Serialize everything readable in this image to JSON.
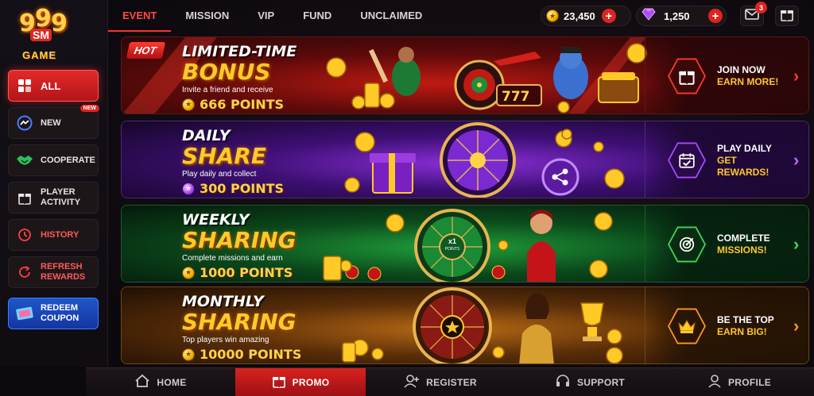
{
  "logo": {
    "digits": [
      "9",
      "9",
      "9"
    ],
    "mark": "SM",
    "text": "GAME"
  },
  "sidebar": {
    "items": [
      {
        "label": "ALL",
        "icon": "grid-icon",
        "active": true
      },
      {
        "label": "NEW",
        "icon": "messenger-icon",
        "badge": "NEW"
      },
      {
        "label": "COOPERATE",
        "icon": "handshake-icon"
      },
      {
        "label": "PLAYER ACTIVITY",
        "icon": "gift-icon"
      },
      {
        "label": "HISTORY",
        "icon": "history-icon"
      },
      {
        "label": "REFRESH REWARDS",
        "icon": "refresh-icon"
      },
      {
        "label": "REDEEM COUPON",
        "icon": "coupon-icon"
      }
    ]
  },
  "tabs": [
    "EVENT",
    "MISSION",
    "VIP",
    "FUND",
    "UNCLAIMED"
  ],
  "wallet": {
    "coins": "23,450",
    "gems": "1,250",
    "mail_count": "3"
  },
  "banners": [
    {
      "hot": "HOT",
      "line1": "LIMITED-TIME",
      "line2": "BONUS",
      "sub": "Invite a friend and receive",
      "points": "666 POINTS",
      "cta1": "JOIN NOW",
      "cta2": "EARN MORE!",
      "cta_icon": "gift-icon",
      "accent": "#ff2a2a",
      "theme": "red"
    },
    {
      "line1": "DAILY",
      "line2": "SHARE",
      "sub": "Play daily and collect",
      "points": "300 POINTS",
      "cta1": "PLAY DAILY",
      "cta2": "GET REWARDS!",
      "cta_icon": "calendar-check-icon",
      "accent": "#a54bff",
      "theme": "purple"
    },
    {
      "line1": "WEEKLY",
      "line2": "SHARING",
      "sub": "Complete missions and earn",
      "points": "1000 POINTS",
      "cta1": "COMPLETE",
      "cta2": "MISSIONS!",
      "cta_icon": "target-icon",
      "accent": "#3ddc5a",
      "theme": "green",
      "wheel_label": "x1",
      "wheel_sub": "POINTS"
    },
    {
      "line1": "MONTHLY",
      "line2": "SHARING",
      "sub": "Top players win amazing",
      "points": "10000 POINTS",
      "cta1": "BE THE TOP",
      "cta2": "EARN BIG!",
      "cta_icon": "crown-icon",
      "accent": "#ff9a1a",
      "theme": "gold"
    }
  ],
  "bottom_nav": [
    {
      "label": "HOME",
      "icon": "home-icon"
    },
    {
      "label": "PROMO",
      "icon": "gift-icon",
      "active": true
    },
    {
      "label": "REGISTER",
      "icon": "add-user-icon"
    },
    {
      "label": "SUPPORT",
      "icon": "headset-icon"
    },
    {
      "label": "PROFILE",
      "icon": "user-icon"
    }
  ]
}
